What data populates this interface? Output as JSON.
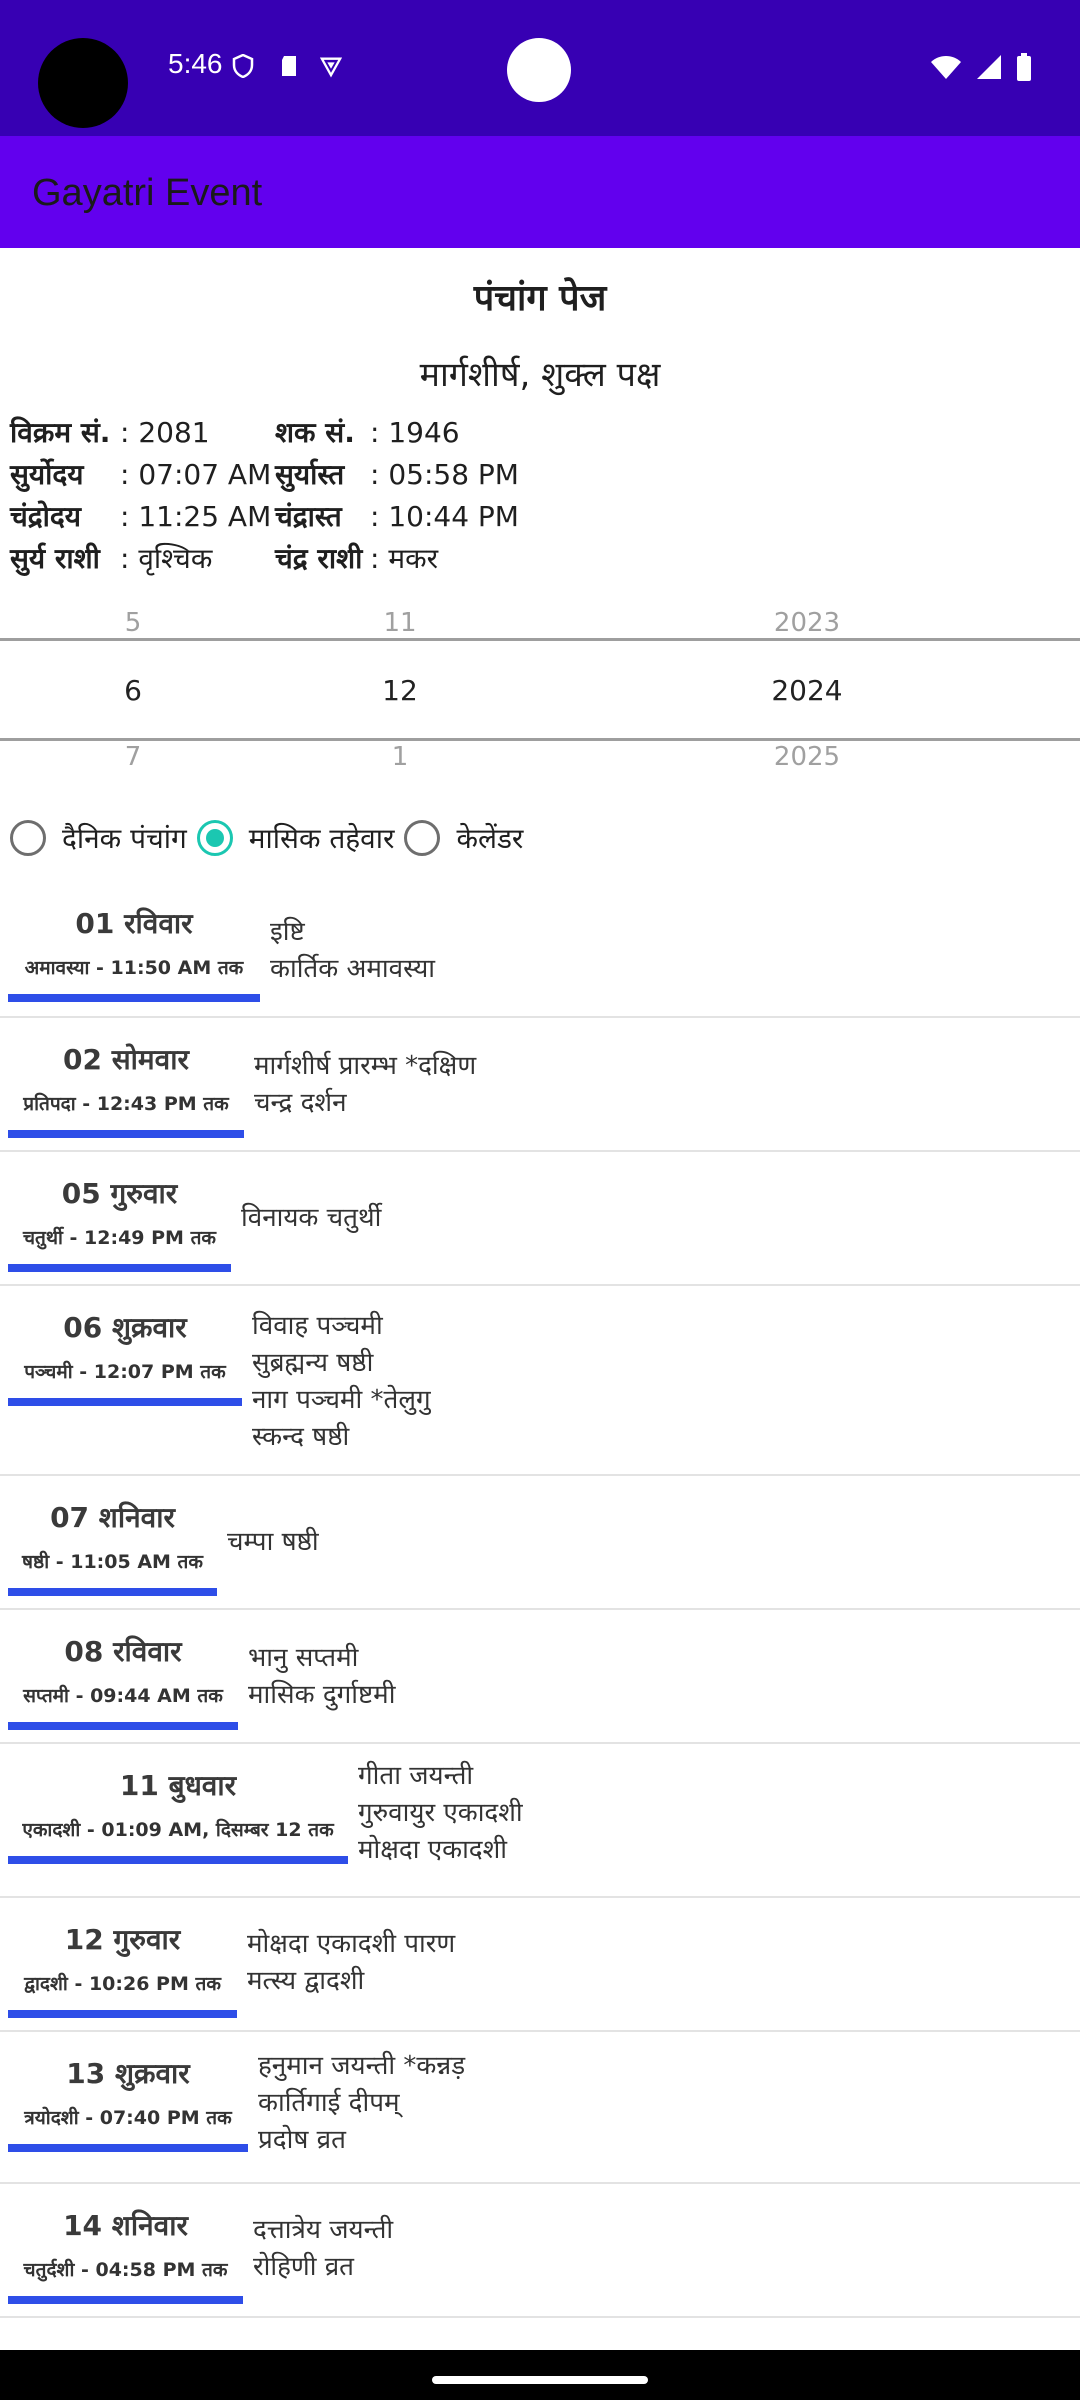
{
  "status_bar": {
    "time": "5:46"
  },
  "app_bar": {
    "title": "Gayatri Event"
  },
  "header": {
    "title": "पंचांग पेज",
    "month": "मार्गशीर्ष, शुक्ल पक्ष"
  },
  "info": [
    {
      "l1": "विक्रम सं.",
      "v1": ": 2081",
      "l2": "शक सं.",
      "v2": ": 1946"
    },
    {
      "l1": "सुर्योदय",
      "v1": ": 07:07 AM",
      "l2": "सुर्यास्त",
      "v2": ": 05:58 PM"
    },
    {
      "l1": "चंद्रोदय",
      "v1": ": 11:25 AM",
      "l2": "चंद्रास्त",
      "v2": ": 10:44 PM"
    },
    {
      "l1": "सुर्य राशी",
      "v1": ": वृश्चिक",
      "l2": "चंद्र राशी",
      "v2": ": मकर"
    }
  ],
  "picker": {
    "day": {
      "prev": "5",
      "sel": "6",
      "next": "7"
    },
    "month": {
      "prev": "11",
      "sel": "12",
      "next": "1"
    },
    "year": {
      "prev": "2023",
      "sel": "2024",
      "next": "2025"
    }
  },
  "radios": [
    {
      "label": "दैनिक पंचांग",
      "selected": false
    },
    {
      "label": "मासिक तहेवार",
      "selected": true
    },
    {
      "label": "केलेंडर",
      "selected": false
    }
  ],
  "events": [
    {
      "day": "01 रविवार",
      "tithi": "अमावस्या - 11:50 AM तक",
      "items": [
        "इष्टि",
        "कार्तिक अमावस्या"
      ]
    },
    {
      "day": "02 सोमवार",
      "tithi": "प्रतिपदा - 12:43 PM तक",
      "items": [
        "मार्गशीर्ष प्रारम्भ *दक्षिण",
        "चन्द्र दर्शन"
      ]
    },
    {
      "day": "05 गुरुवार",
      "tithi": "चतुर्थी - 12:49 PM तक",
      "items": [
        "विनायक चतुर्थी"
      ]
    },
    {
      "day": "06 शुक्रवार",
      "tithi": "पञ्चमी - 12:07 PM तक",
      "items": [
        "विवाह पञ्चमी",
        "सुब्रह्मन्य षष्ठी",
        "नाग पञ्चमी *तेलुगु",
        "स्कन्द षष्ठी"
      ]
    },
    {
      "day": "07 शनिवार",
      "tithi": "षष्ठी - 11:05 AM तक",
      "items": [
        "चम्पा षष्ठी"
      ]
    },
    {
      "day": "08 रविवार",
      "tithi": "सप्तमी - 09:44 AM तक",
      "items": [
        "भानु सप्तमी",
        "मासिक दुर्गाष्टमी"
      ]
    },
    {
      "day": "11 बुधवार",
      "tithi": "एकादशी - 01:09 AM, दिसम्बर 12 तक",
      "items": [
        "गीता जयन्ती",
        "गुरुवायुर एकादशी",
        "मोक्षदा एकादशी"
      ]
    },
    {
      "day": "12 गुरुवार",
      "tithi": "द्वादशी - 10:26 PM तक",
      "items": [
        "मोक्षदा एकादशी पारण",
        "मत्स्य द्वादशी"
      ]
    },
    {
      "day": "13 शुक्रवार",
      "tithi": "त्रयोदशी - 07:40 PM तक",
      "items": [
        "हनुमान जयन्ती *कन्नड़",
        "कार्तिगाई दीपम्",
        "प्रदोष व्रत"
      ]
    },
    {
      "day": "14 शनिवार",
      "tithi": "चतुर्दशी - 04:58 PM तक",
      "items": [
        "दत्तात्रेय जयन्ती",
        "रोहिणी व्रत"
      ]
    }
  ]
}
